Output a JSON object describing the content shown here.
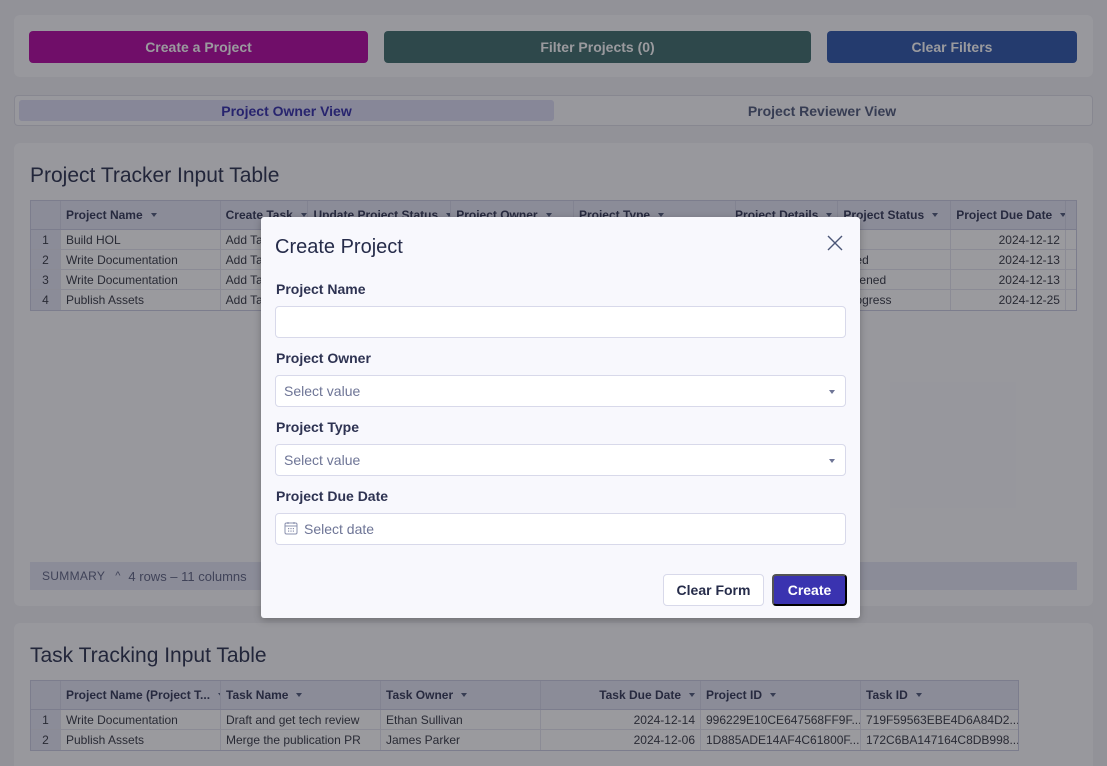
{
  "toolbar": {
    "create_label": "Create a Project",
    "filter_label": "Filter Projects (0)",
    "clear_label": "Clear Filters"
  },
  "tabs": [
    {
      "label": "Project Owner View",
      "active": true
    },
    {
      "label": "Project Reviewer View",
      "active": false
    }
  ],
  "project_table": {
    "title": "Project Tracker Input Table",
    "columns": [
      "Project Name",
      "Create Task",
      "Update Project Status",
      "Project Owner",
      "Project Type",
      "Project Details",
      "Project Status",
      "Project Due Date"
    ],
    "rows": [
      {
        "idx": "1",
        "name": "Build HOL",
        "create_task": "Add Ta",
        "status": "",
        "due": "2024-12-12"
      },
      {
        "idx": "2",
        "name": "Write Documentation",
        "create_task": "Add Ta",
        "status": "cked",
        "due": "2024-12-13"
      },
      {
        "idx": "3",
        "name": "Write Documentation",
        "create_task": "Add Ta",
        "status": "Opened",
        "due": "2024-12-13"
      },
      {
        "idx": "4",
        "name": "Publish Assets",
        "create_task": "Add Ta",
        "status": "Progress",
        "due": "2024-12-25"
      }
    ],
    "summary_label": "SUMMARY",
    "summary_count": "4 rows – 11 columns"
  },
  "task_table": {
    "title": "Task Tracking Input Table",
    "columns": [
      "Project Name (Project T...",
      "Task Name",
      "Task Owner",
      "Task Due Date",
      "Project ID",
      "Task ID"
    ],
    "rows": [
      {
        "idx": "1",
        "project": "Write Documentation",
        "task": "Draft and get tech review",
        "owner": "Ethan Sullivan",
        "due": "2024-12-14",
        "project_id": "996229E10CE647568FF9F...",
        "task_id": "719F59563EBE4D6A84D2..."
      },
      {
        "idx": "2",
        "project": "Publish Assets",
        "task": "Merge the publication PR",
        "owner": "James Parker",
        "due": "2024-12-06",
        "project_id": "1D885ADE14AF4C61800F...",
        "task_id": "172C6BA147164C8DB998..."
      }
    ]
  },
  "modal": {
    "title": "Create Project",
    "fields": [
      {
        "label": "Project Name",
        "value": "",
        "placeholder": ""
      },
      {
        "label": "Project Owner",
        "placeholder": "Select value"
      },
      {
        "label": "Project Type",
        "placeholder": "Select value"
      },
      {
        "label": "Project Due Date",
        "placeholder": "Select date"
      }
    ],
    "clear_label": "Clear Form",
    "create_label": "Create",
    "close_icon": "close-icon",
    "calendar_icon": "calendar-icon"
  },
  "colors": {
    "create_button": "#b3019f",
    "filter_button": "#3b6b69",
    "clear_button": "#2853a8",
    "primary": "#3a33b0"
  }
}
